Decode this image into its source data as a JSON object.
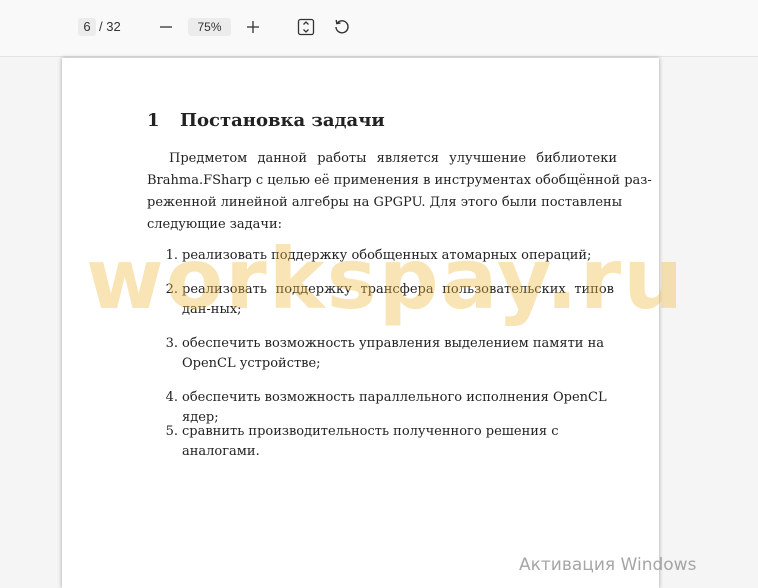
{
  "toolbar": {
    "current_page": "6",
    "total_pages": "/ 32",
    "zoom": "75%",
    "icons": {
      "zoom_out": "minus-icon",
      "zoom_in": "plus-icon",
      "fit": "fit-page-icon",
      "rotate": "rotate-icon"
    }
  },
  "document": {
    "section_number": "1",
    "section_title": "Постановка задачи",
    "intro_lines": [
      "Предметом данной работы является улучшение библиотеки",
      "Brahma.FSharp с целью её применения в инструментах обобщённой раз-",
      "реженной линейной алгебры на GPGPU. Для этого были поставлены",
      "следующие задачи:"
    ],
    "tasks": [
      {
        "num": "1.",
        "text": "реализовать поддержку обобщенных атомарных операций;"
      },
      {
        "num": "2.",
        "text": "реализовать поддержку трансфера пользовательских типов дан-ных;"
      },
      {
        "num": "3.",
        "text": "обеспечить возможность управления выделением памяти на OpenCL устройстве;"
      },
      {
        "num": "4.",
        "text": "обеспечить возможность параллельного исполнения OpenCL ядер;"
      },
      {
        "num": "5.",
        "text": "сравнить производительность полученного решения с аналогами."
      }
    ]
  },
  "watermark": "workspay.ru",
  "system_overlay": "Активация Windows",
  "colors": {
    "watermark": "#f0b93c",
    "page_bg": "#ffffff",
    "viewer_bg": "#f5f5f5"
  }
}
